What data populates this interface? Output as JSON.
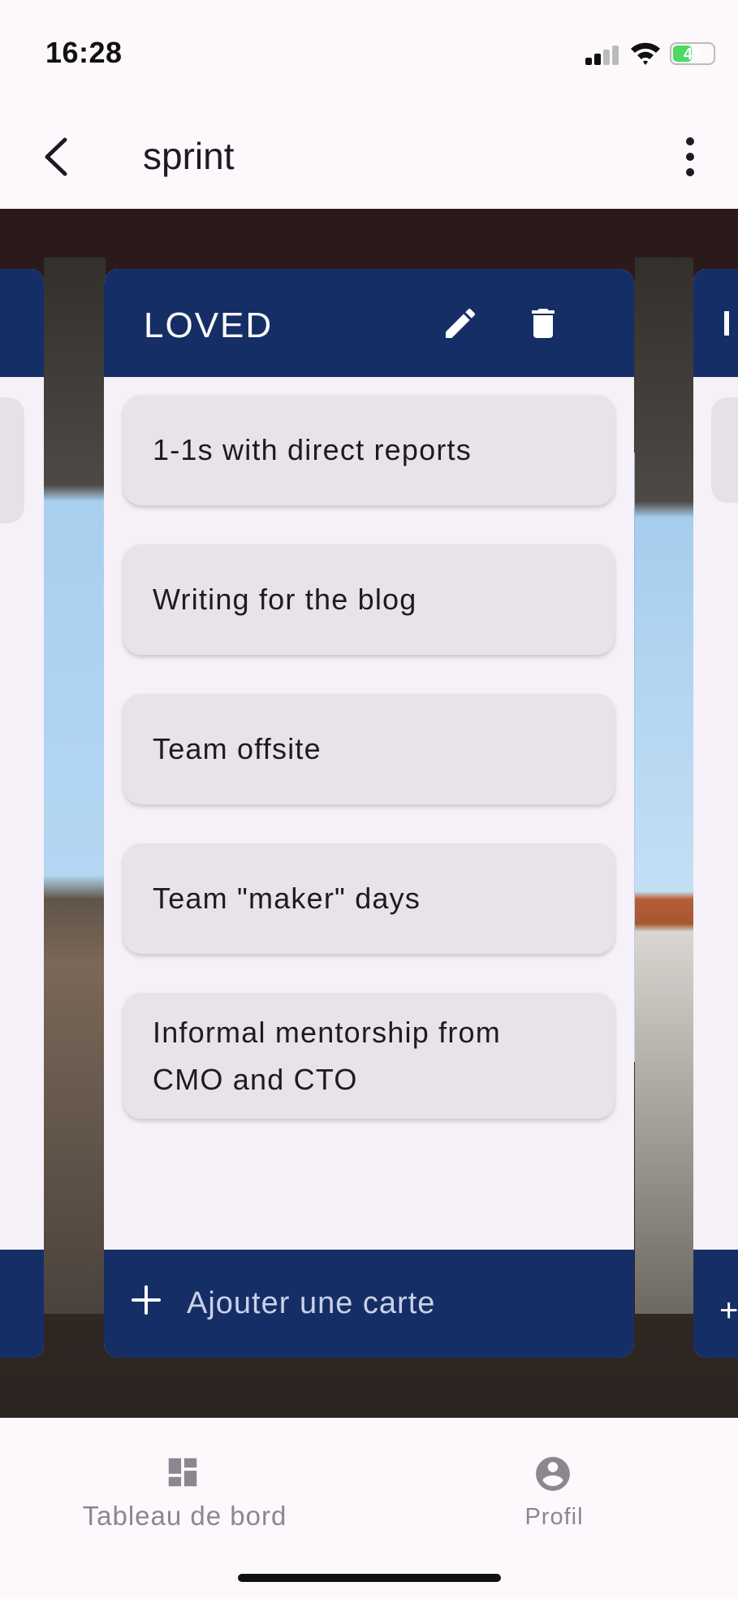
{
  "status_bar": {
    "time": "16:28",
    "battery": "47",
    "battery_level": 0.47
  },
  "app_bar": {
    "title": "sprint"
  },
  "list": {
    "title": "LOVED",
    "cards": [
      "1-1s with direct reports",
      "Writing for the blog",
      "Team offsite",
      "Team \"maker\" days",
      "Informal mentorship from CMO and CTO"
    ],
    "add_card_label": "Ajouter une carte"
  },
  "bottom_nav": {
    "items": [
      {
        "label": "Tableau de bord",
        "icon": "dashboard-icon"
      },
      {
        "label": "Profil",
        "icon": "account-circle-icon"
      }
    ]
  },
  "colors": {
    "list_header": "#162e66",
    "card_background": "#e7e3e8",
    "list_background": "#f6f1f8"
  }
}
